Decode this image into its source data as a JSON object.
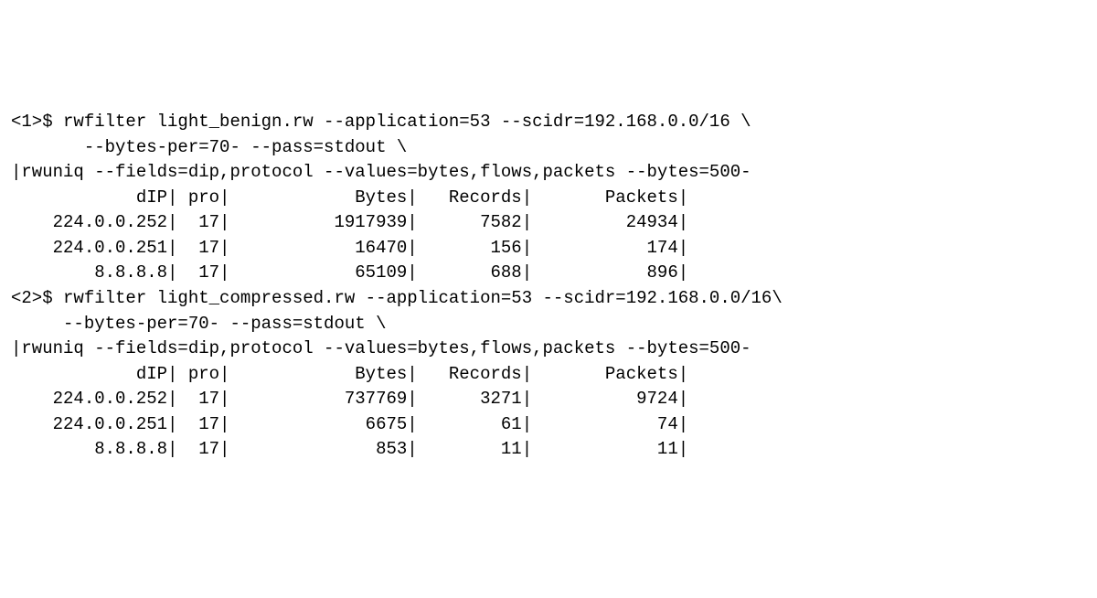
{
  "block1": {
    "prompt": "<1>$ ",
    "cmd_lines": [
      "rwfilter light_benign.rw --application=53 --scidr=192.168.0.0/16 \\",
      "     --bytes-per=70- --pass=stdout \\",
      "|rwuniq --fields=dip,protocol --values=bytes,flows,packets --bytes=500-"
    ],
    "header": {
      "dip": "dIP",
      "pro": "pro",
      "bytes": "Bytes",
      "records": "Records",
      "packets": "Packets"
    },
    "rows": [
      {
        "dip": "224.0.0.252",
        "pro": "17",
        "bytes": "1917939",
        "records": "7582",
        "packets": "24934"
      },
      {
        "dip": "224.0.0.251",
        "pro": "17",
        "bytes": "16470",
        "records": "156",
        "packets": "174"
      },
      {
        "dip": "8.8.8.8",
        "pro": "17",
        "bytes": "65109",
        "records": "688",
        "packets": "896"
      }
    ]
  },
  "block2": {
    "prompt": "<2>$ ",
    "cmd_lines": [
      "rwfilter light_compressed.rw --application=53 --scidr=192.168.0.0/16\\",
      "   --bytes-per=70- --pass=stdout \\",
      "|rwuniq --fields=dip,protocol --values=bytes,flows,packets --bytes=500-"
    ],
    "header": {
      "dip": "dIP",
      "pro": "pro",
      "bytes": "Bytes",
      "records": "Records",
      "packets": "Packets"
    },
    "rows": [
      {
        "dip": "224.0.0.252",
        "pro": "17",
        "bytes": "737769",
        "records": "3271",
        "packets": "9724"
      },
      {
        "dip": "224.0.0.251",
        "pro": "17",
        "bytes": "6675",
        "records": "61",
        "packets": "74"
      },
      {
        "dip": "8.8.8.8",
        "pro": "17",
        "bytes": "853",
        "records": "11",
        "packets": "11"
      }
    ]
  },
  "col_widths": {
    "dip": 15,
    "pro": 4,
    "bytes": 17,
    "records": 10,
    "packets": 14
  }
}
